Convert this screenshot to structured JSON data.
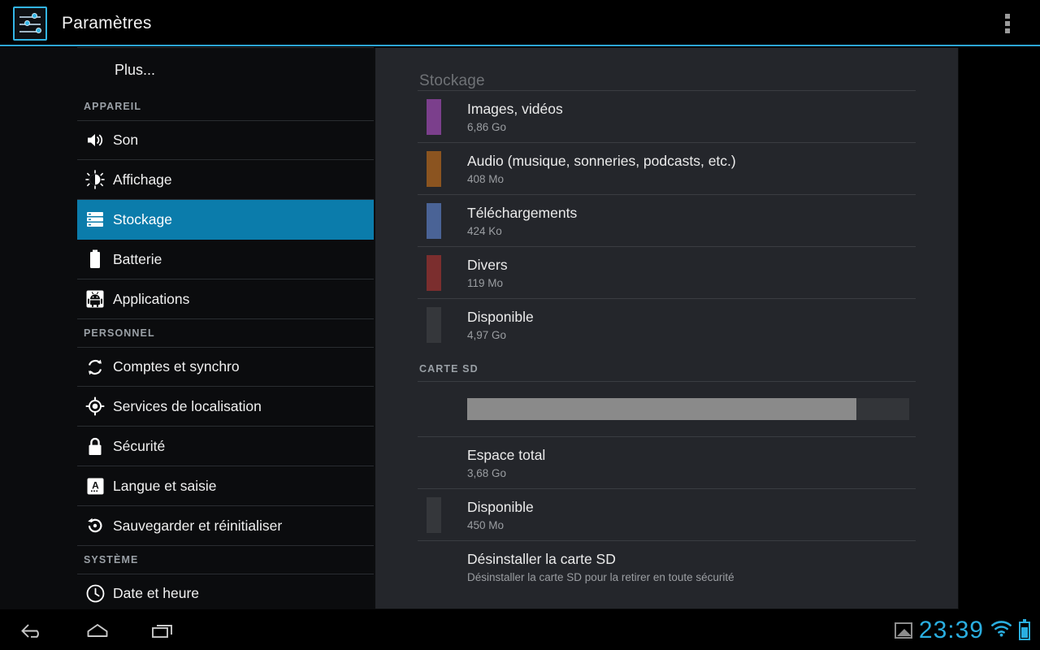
{
  "actionbar": {
    "title": "Paramètres",
    "app_icon": "settings-sliders-icon",
    "overflow_icon": "overflow-menu-icon",
    "accent_color": "#2da5d4"
  },
  "sidebar": {
    "top_item": {
      "label": "Plus...",
      "selected": false
    },
    "groups": [
      {
        "header": "APPAREIL",
        "items": [
          {
            "label": "Son",
            "icon": "sound-icon",
            "selected": false
          },
          {
            "label": "Affichage",
            "icon": "display-brightness-icon",
            "selected": false
          },
          {
            "label": "Stockage",
            "icon": "storage-icon",
            "selected": true
          },
          {
            "label": "Batterie",
            "icon": "battery-icon",
            "selected": false
          },
          {
            "label": "Applications",
            "icon": "android-apps-icon",
            "selected": false
          }
        ]
      },
      {
        "header": "PERSONNEL",
        "items": [
          {
            "label": "Comptes et synchro",
            "icon": "sync-icon",
            "selected": false
          },
          {
            "label": "Services de localisation",
            "icon": "location-icon",
            "selected": false
          },
          {
            "label": "Sécurité",
            "icon": "lock-icon",
            "selected": false
          },
          {
            "label": "Langue et saisie",
            "icon": "language-input-icon",
            "selected": false
          },
          {
            "label": "Sauvegarder et réinitialiser",
            "icon": "backup-reset-icon",
            "selected": false
          }
        ]
      },
      {
        "header": "SYSTÈME",
        "items": [
          {
            "label": "Date et heure",
            "icon": "clock-icon",
            "selected": false
          }
        ]
      }
    ],
    "selected_color": "#0b7cab"
  },
  "panel": {
    "title": "Stockage",
    "internal": [
      {
        "name": "Images, vidéos",
        "size": "6,86 Go",
        "color": "#7b3f8c"
      },
      {
        "name": "Audio (musique, sonneries, podcasts, etc.)",
        "size": "408 Mo",
        "color": "#8b5420"
      },
      {
        "name": "Téléchargements",
        "size": "424 Ko",
        "color": "#4a6396"
      },
      {
        "name": "Divers",
        "size": "119 Mo",
        "color": "#7b2e2e"
      },
      {
        "name": "Disponible",
        "size": "4,97 Go",
        "color": "#35373b"
      }
    ],
    "sd_header": "CARTE SD",
    "sd_bar": {
      "used_percent": 88,
      "fill_color": "#8a8a8a",
      "track_color": "#333539"
    },
    "sd_rows": [
      {
        "name": "Espace total",
        "size": "3,68 Go",
        "color": null
      },
      {
        "name": "Disponible",
        "size": "450 Mo",
        "color": "#35373b"
      }
    ],
    "unmount": {
      "name": "Désinstaller la carte SD",
      "sub": "Désinstaller la carte SD pour la retirer en toute sécurité"
    }
  },
  "sysbar": {
    "nav": [
      {
        "name": "back",
        "icon": "back-arrow-icon"
      },
      {
        "name": "home",
        "icon": "home-icon"
      },
      {
        "name": "recents",
        "icon": "recents-icon"
      }
    ],
    "screenshot_icon": "screenshot-image-icon",
    "clock": "23:39",
    "wifi_icon": "wifi-icon",
    "battery_icon": "battery-icon",
    "accent_color": "#2aaee0"
  }
}
